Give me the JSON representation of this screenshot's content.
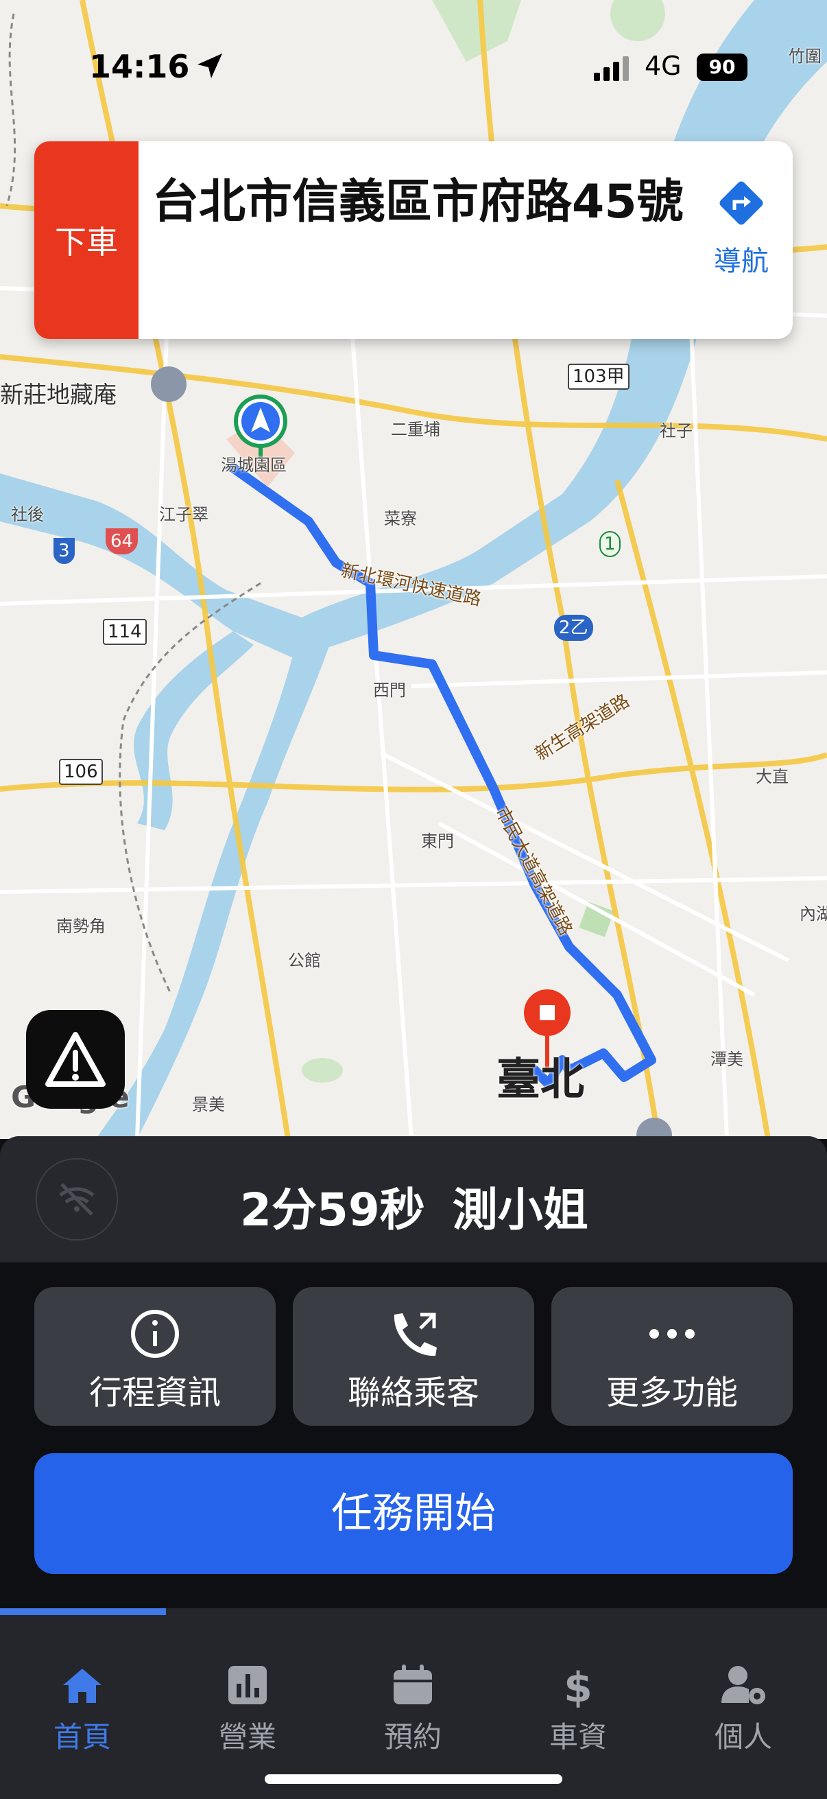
{
  "status": {
    "time": "14:16",
    "network": "4G",
    "battery": "90"
  },
  "destination": {
    "tag": "下車",
    "address": "台北市信義區市府路45號",
    "nav_label": "導航"
  },
  "map": {
    "labels": {
      "xinzhuang": "新莊地藏庵",
      "tangcheng": "湯城園區",
      "erchongpu": "二重埔",
      "shezi": "社子",
      "shehou": "社後",
      "jiangzicui": "江子翠",
      "cailiao": "菜寮",
      "ximen": "西門",
      "dazhi": "大直",
      "dongmen": "東門",
      "nanshijiao": "南勢角",
      "gongguan": "公館",
      "jingmei": "景美",
      "tanmei": "潭美",
      "neihu": "內湖",
      "taipei": "臺北",
      "zhuwei": "竹圍"
    },
    "roads": {
      "huanhe": "新北環河快速道路",
      "xinsheng": "新生高架道路",
      "civic": "市民大道高架道路"
    },
    "shields": {
      "s103": "103甲",
      "s114": "114",
      "s106": "106",
      "s3": "3",
      "s64": "64",
      "s2": "2乙",
      "s1": "1"
    },
    "logo": "Google"
  },
  "trip": {
    "eta": "2分59秒",
    "passenger": "測小姐"
  },
  "actions": [
    {
      "label": "行程資訊",
      "icon": "info-icon"
    },
    {
      "label": "聯絡乘客",
      "icon": "phone-icon"
    },
    {
      "label": "更多功能",
      "icon": "more-icon"
    }
  ],
  "start_button": "任務開始",
  "tabs": [
    {
      "label": "首頁",
      "icon": "home-icon",
      "active": true
    },
    {
      "label": "營業",
      "icon": "chart-icon"
    },
    {
      "label": "預約",
      "icon": "calendar-icon"
    },
    {
      "label": "車資",
      "icon": "dollar-icon"
    },
    {
      "label": "個人",
      "icon": "user-settings-icon"
    }
  ],
  "colors": {
    "accent": "#2563eb",
    "tag": "#e8371e",
    "route": "#2f6ff0"
  }
}
